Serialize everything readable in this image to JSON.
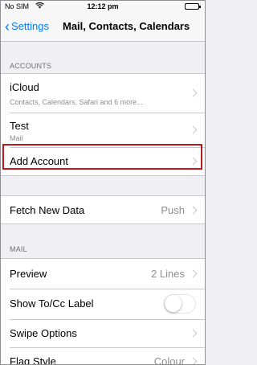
{
  "status_bar": {
    "carrier": "No SIM",
    "wifi_icon": "wifi-icon",
    "time": "12:12 pm",
    "battery_icon": "battery-icon"
  },
  "nav": {
    "back_label": "Settings",
    "title": "Mail, Contacts, Calendars"
  },
  "accounts": {
    "header": "ACCOUNTS",
    "items": [
      {
        "title": "iCloud",
        "subtitle": "Contacts, Calendars, Safari and 6 more..."
      },
      {
        "title": "Test",
        "subtitle": "Mail"
      },
      {
        "title": "Add Account"
      }
    ]
  },
  "fetch": {
    "title": "Fetch New Data",
    "value": "Push"
  },
  "mail": {
    "header": "MAIL",
    "preview": {
      "title": "Preview",
      "value": "2 Lines"
    },
    "show_tocc": {
      "title": "Show To/Cc Label",
      "on": false
    },
    "swipe": {
      "title": "Swipe Options"
    },
    "flag_style": {
      "title": "Flag Style",
      "value": "Colour"
    }
  },
  "colors": {
    "accent": "#007aff",
    "highlight_border": "#b71c1c",
    "background": "#efeff4"
  }
}
